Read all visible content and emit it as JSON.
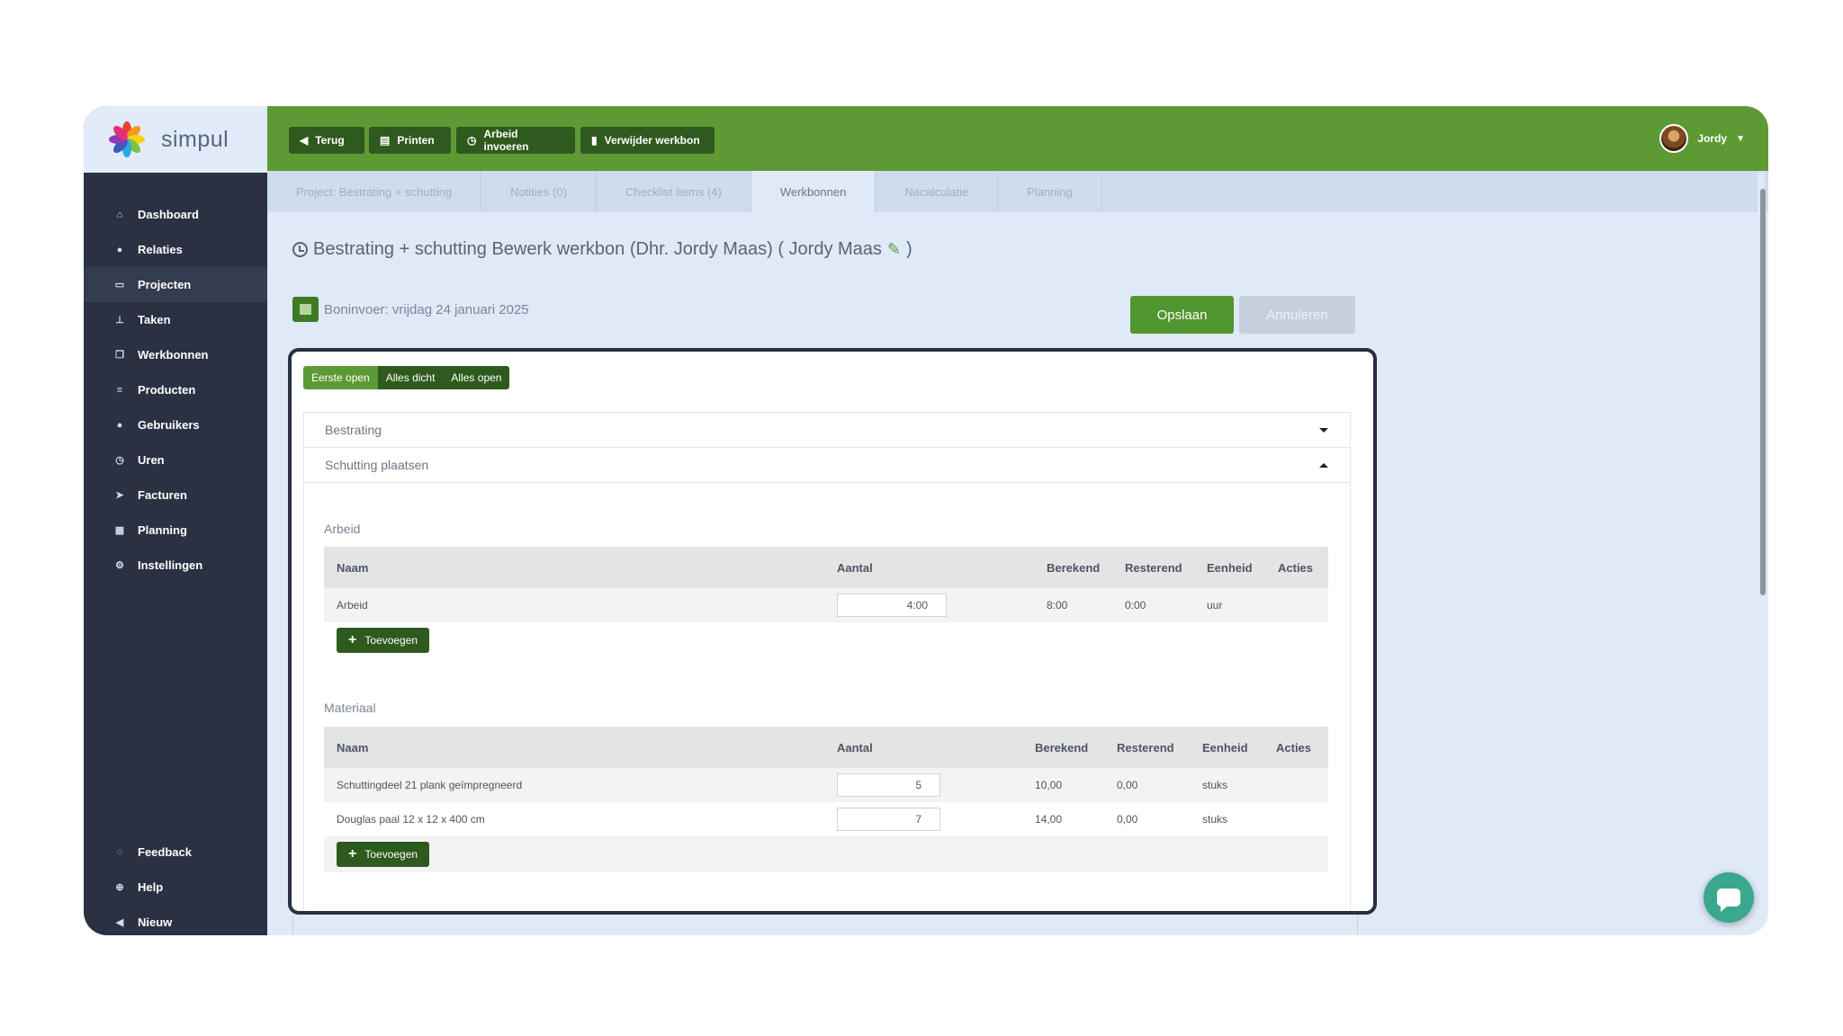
{
  "app": {
    "logo_text": "simpul"
  },
  "sidebar": {
    "items": [
      {
        "label": "Dashboard",
        "icon": "home-icon"
      },
      {
        "label": "Relaties",
        "icon": "user-icon"
      },
      {
        "label": "Projecten",
        "icon": "folder-icon"
      },
      {
        "label": "Taken",
        "icon": "pin-icon"
      },
      {
        "label": "Werkbonnen",
        "icon": "copy-icon"
      },
      {
        "label": "Producten",
        "icon": "list-icon"
      },
      {
        "label": "Gebruikers",
        "icon": "users-icon"
      },
      {
        "label": "Uren",
        "icon": "clock-icon"
      },
      {
        "label": "Facturen",
        "icon": "send-icon"
      },
      {
        "label": "Planning",
        "icon": "calendar-icon"
      },
      {
        "label": "Instellingen",
        "icon": "gear-icon"
      }
    ],
    "active_index": 2,
    "bottom_items": [
      {
        "label": "Feedback",
        "icon": "comment-icon"
      },
      {
        "label": "Help",
        "icon": "lifebuoy-icon"
      },
      {
        "label": "Nieuw",
        "icon": "megaphone-icon"
      }
    ]
  },
  "toolbar": {
    "back": "Terug",
    "print": "Printen",
    "labor": "Arbeid invoeren",
    "delete": "Verwijder werkbon"
  },
  "user": {
    "name": "Jordy"
  },
  "tabs": [
    "Project: Bestrating + schutting",
    "Notities (0)",
    "Checklist items (4)",
    "Werkbonnen",
    "Nacalculatie",
    "Planning"
  ],
  "page": {
    "title_main": "Bestrating + schutting Bewerk werkbon (Dhr. Jordy Maas) ( Jordy Maas",
    "title_close": ")",
    "date_text": "Boninvoer: vrijdag 24 januari 2025",
    "save": "Opslaan",
    "cancel": "Annuleren"
  },
  "accordion_controls": {
    "first_open": "Eerste open",
    "all_closed": "Alles dicht",
    "all_open": "Alles open"
  },
  "accordion": {
    "panel1": "Bestrating",
    "panel2": "Schutting plaatsen"
  },
  "arbeid": {
    "title": "Arbeid",
    "headers": {
      "naam": "Naam",
      "aantal": "Aantal",
      "berekend": "Berekend",
      "resterend": "Resterend",
      "eenheid": "Eenheid",
      "acties": "Acties"
    },
    "rows": [
      {
        "naam": "Arbeid",
        "aantal": "4:00",
        "berekend": "8:00",
        "resterend": "0:00",
        "eenheid": "uur"
      }
    ],
    "add": "Toevoegen"
  },
  "materiaal": {
    "title": "Materiaal",
    "headers": {
      "naam": "Naam",
      "aantal": "Aantal",
      "berekend": "Berekend",
      "resterend": "Resterend",
      "eenheid": "Eenheid",
      "acties": "Acties"
    },
    "rows": [
      {
        "naam": "Schuttingdeel 21 plank geïmpregneerd",
        "aantal": "5",
        "berekend": "10,00",
        "resterend": "0,00",
        "eenheid": "stuks"
      },
      {
        "naam": "Douglas paal 12 x 12 x 400 cm",
        "aantal": "7",
        "berekend": "14,00",
        "resterend": "0,00",
        "eenheid": "stuks"
      }
    ],
    "add": "Toevoegen"
  },
  "colors": {
    "primary_green": "#5e9a34",
    "dark_green": "#2f5a1e",
    "sidebar": "#2a3142",
    "content_bg": "#dfe9f8"
  }
}
